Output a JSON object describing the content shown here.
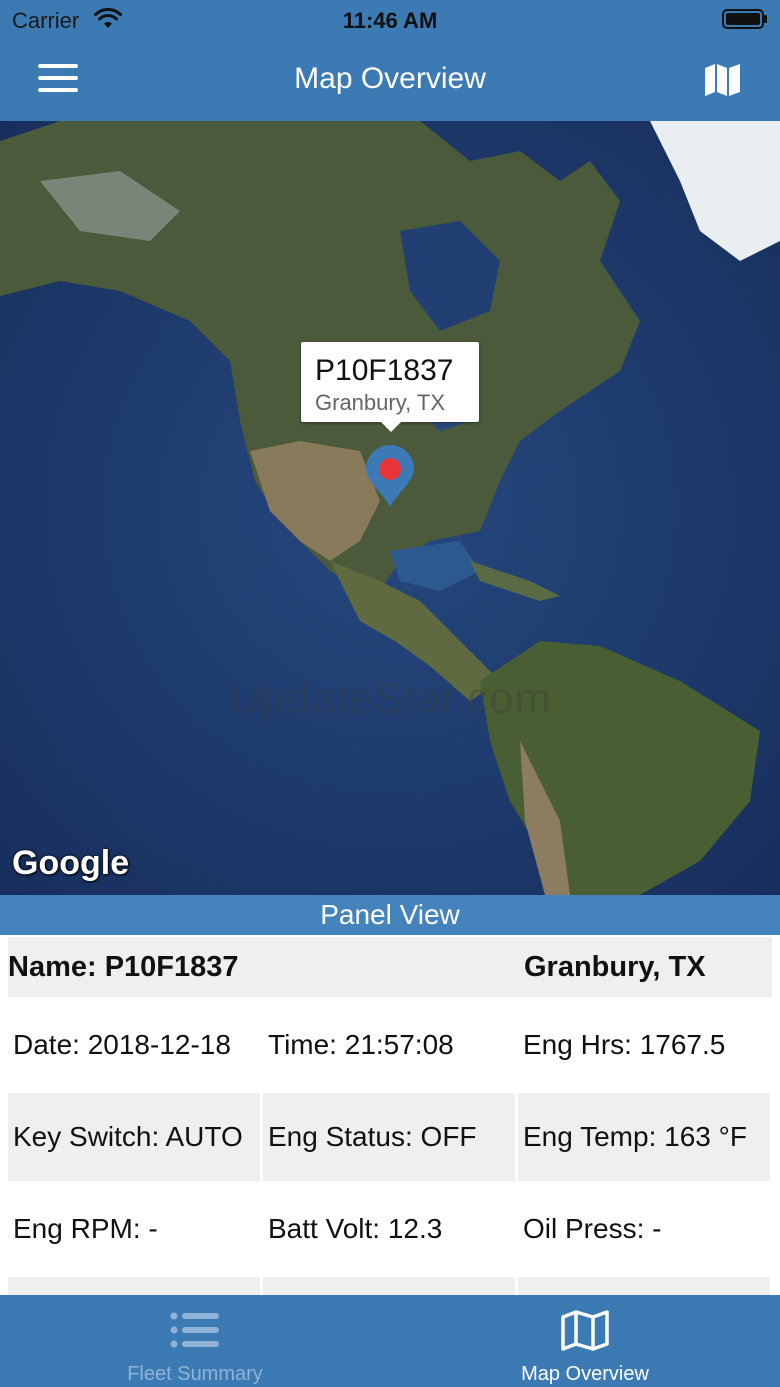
{
  "status_bar": {
    "carrier": "Carrier",
    "time": "11:46 AM",
    "wifi_icon": "wifi-icon",
    "battery_icon": "battery-icon"
  },
  "nav": {
    "title": "Map Overview",
    "menu_icon": "hamburger-menu-icon",
    "right_icon": "map-icon"
  },
  "map": {
    "marker": {
      "title": "P10F1837",
      "subtitle": "Granbury, TX",
      "pin_color": "#3b7ab7",
      "dot_color": "#e8333a"
    },
    "watermark": "UpdateStar.com",
    "attribution": "Google"
  },
  "panel": {
    "header": "Panel View",
    "name_label": "Name: P10F1837",
    "location": "Granbury, TX",
    "rows": [
      [
        "Date: 2018-12-18",
        "Time: 21:57:08",
        "Eng Hrs: 1767.5"
      ],
      [
        "Key Switch: AUTO",
        "Eng Status: OFF",
        "Eng Temp: 163 °F"
      ],
      [
        "Eng RPM: -",
        "Batt Volt: 12.3",
        "Oil Press: -"
      ],
      [
        "",
        "",
        ""
      ]
    ]
  },
  "tabs": [
    {
      "label": "Fleet Summary",
      "icon": "list-icon",
      "active": false
    },
    {
      "label": "Map Overview",
      "icon": "map-icon",
      "active": true
    }
  ],
  "colors": {
    "header_blue": "#3c7ab4",
    "panel_header_blue": "#4583bd",
    "row_gray": "#efefef",
    "inactive_tab": "#8fb3d6"
  }
}
